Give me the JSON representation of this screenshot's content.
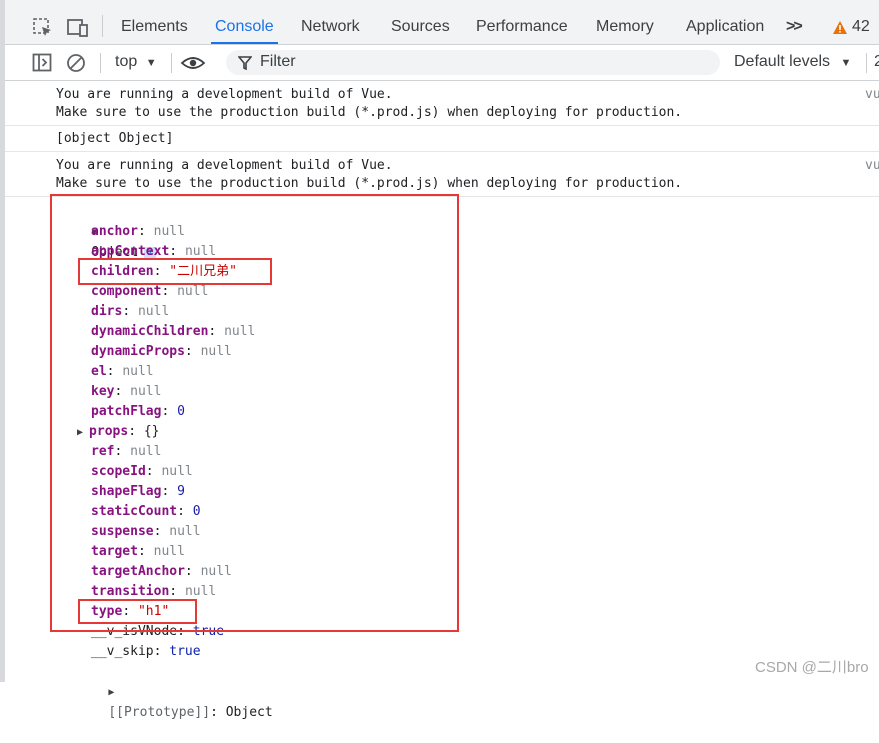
{
  "tabs": {
    "elements": "Elements",
    "console": "Console",
    "network": "Network",
    "sources": "Sources",
    "performance": "Performance",
    "memory": "Memory",
    "application": "Application",
    "more": ">>",
    "warning_count": "42"
  },
  "toolbar": {
    "context": "top",
    "filter_placeholder": "Filter",
    "levels": "Default levels",
    "issues_count": "2"
  },
  "messages": {
    "vue_warning_1": {
      "line1": "You are running a development build of Vue.",
      "line2": "Make sure to use the production build (*.prod.js) when deploying for production.",
      "source": "vu"
    },
    "object_string": "[object Object]",
    "vue_warning_2": {
      "line1": "You are running a development build of Vue.",
      "line2": "Make sure to use the production build (*.prod.js) when deploying for production.",
      "source": "vu"
    }
  },
  "object_tree": {
    "label": "Object",
    "info": "i",
    "props": [
      {
        "key": "anchor",
        "value": "null",
        "type": "null"
      },
      {
        "key": "appContext",
        "value": "null",
        "type": "null"
      },
      {
        "key": "children",
        "value": "\"二川兄弟\"",
        "type": "string"
      },
      {
        "key": "component",
        "value": "null",
        "type": "null"
      },
      {
        "key": "dirs",
        "value": "null",
        "type": "null"
      },
      {
        "key": "dynamicChildren",
        "value": "null",
        "type": "null"
      },
      {
        "key": "dynamicProps",
        "value": "null",
        "type": "null"
      },
      {
        "key": "el",
        "value": "null",
        "type": "null"
      },
      {
        "key": "key",
        "value": "null",
        "type": "null"
      },
      {
        "key": "patchFlag",
        "value": "0",
        "type": "number"
      },
      {
        "key": "props",
        "value": "{}",
        "type": "object"
      },
      {
        "key": "ref",
        "value": "null",
        "type": "null"
      },
      {
        "key": "scopeId",
        "value": "null",
        "type": "null"
      },
      {
        "key": "shapeFlag",
        "value": "9",
        "type": "number"
      },
      {
        "key": "staticCount",
        "value": "0",
        "type": "number"
      },
      {
        "key": "suspense",
        "value": "null",
        "type": "null"
      },
      {
        "key": "target",
        "value": "null",
        "type": "null"
      },
      {
        "key": "targetAnchor",
        "value": "null",
        "type": "null"
      },
      {
        "key": "transition",
        "value": "null",
        "type": "null"
      },
      {
        "key": "type",
        "value": "\"h1\"",
        "type": "string"
      },
      {
        "key": "__v_isVNode",
        "value": "true",
        "type": "bool"
      },
      {
        "key": "__v_skip",
        "value": "true",
        "type": "bool"
      }
    ],
    "prototype_key": "[[Prototype]]",
    "prototype_value": "Object"
  },
  "watermark": "CSDN @二川bro",
  "colors": {
    "accent": "#1a73e8",
    "highlight": "#e53935",
    "warning": "#e8710a"
  }
}
